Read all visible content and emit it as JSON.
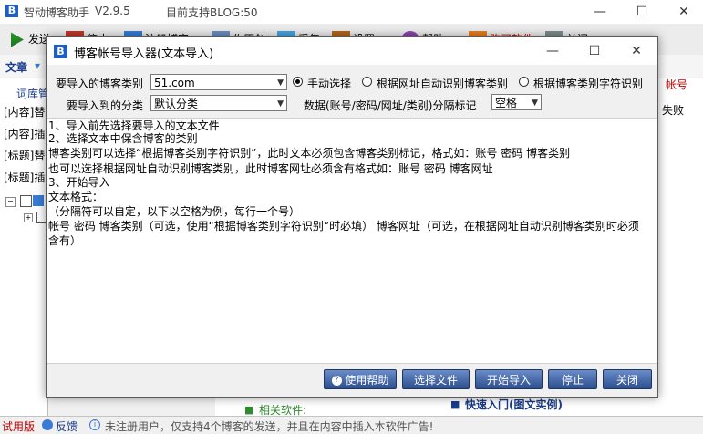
{
  "main": {
    "title": "智动博客助手",
    "version": "V2.9.5",
    "support": "目前支持BLOG:50",
    "toolbar": [
      "发送",
      "停止",
      "注册博客",
      "作原创",
      "采集",
      "设置",
      "帮助",
      "购买软件",
      "关闭"
    ],
    "tab_label": "文章",
    "left_items": [
      "词库管",
      "[内容]替",
      "[内容]插",
      "[标题]替",
      "[标题]插"
    ],
    "right_items": [
      "帐号",
      "失败"
    ],
    "related_label": "相关软件:",
    "quick_link": "快速入门(图文实例)",
    "status": {
      "edition": "试用版",
      "feedback": "反馈",
      "notice": "未注册用户，仅支持4个博客的发送，并且在内容中插入本软件广告!"
    }
  },
  "dialog": {
    "title": "博客帐号导入器(文本导入)",
    "blog_type_label": "要导入的博客类别",
    "blog_type_value": "51.com",
    "radio_manual": "手动选择",
    "radio_url": "根据网址自动识别博客类别",
    "radio_char": "根据博客类别字符识别",
    "category_label": "要导入到的分类",
    "category_value": "默认分类",
    "separator_label": "数据(账号/密码/网址/类别)分隔标记",
    "separator_value": "空格",
    "content_lines": [
      "1、导入前先选择要导入的文本文件",
      "2、选择文本中保含博客的类别",
      "博客类别可以选择“根据博客类别字符识别”，此时文本必须包含博客类别标记，格式如：账号 密码 博客类别",
      "也可以选择根据网址自动识别博客类别，此时博客网址必须含有格式如：账号 密码 博客网址",
      "3、开始导入",
      "文本格式：",
      "（分隔符可以自定，以下以空格为例，每行一个号）",
      "帐号  密码  博客类别（可选，使用“根据博客类别字符识别”时必填） 博客网址（可选，在根据网址自动识别博客类别时必须",
      "含有）"
    ],
    "buttons": {
      "help": "使用帮助",
      "select_file": "选择文件",
      "start_import": "开始导入",
      "stop": "停止",
      "close": "关闭"
    }
  }
}
